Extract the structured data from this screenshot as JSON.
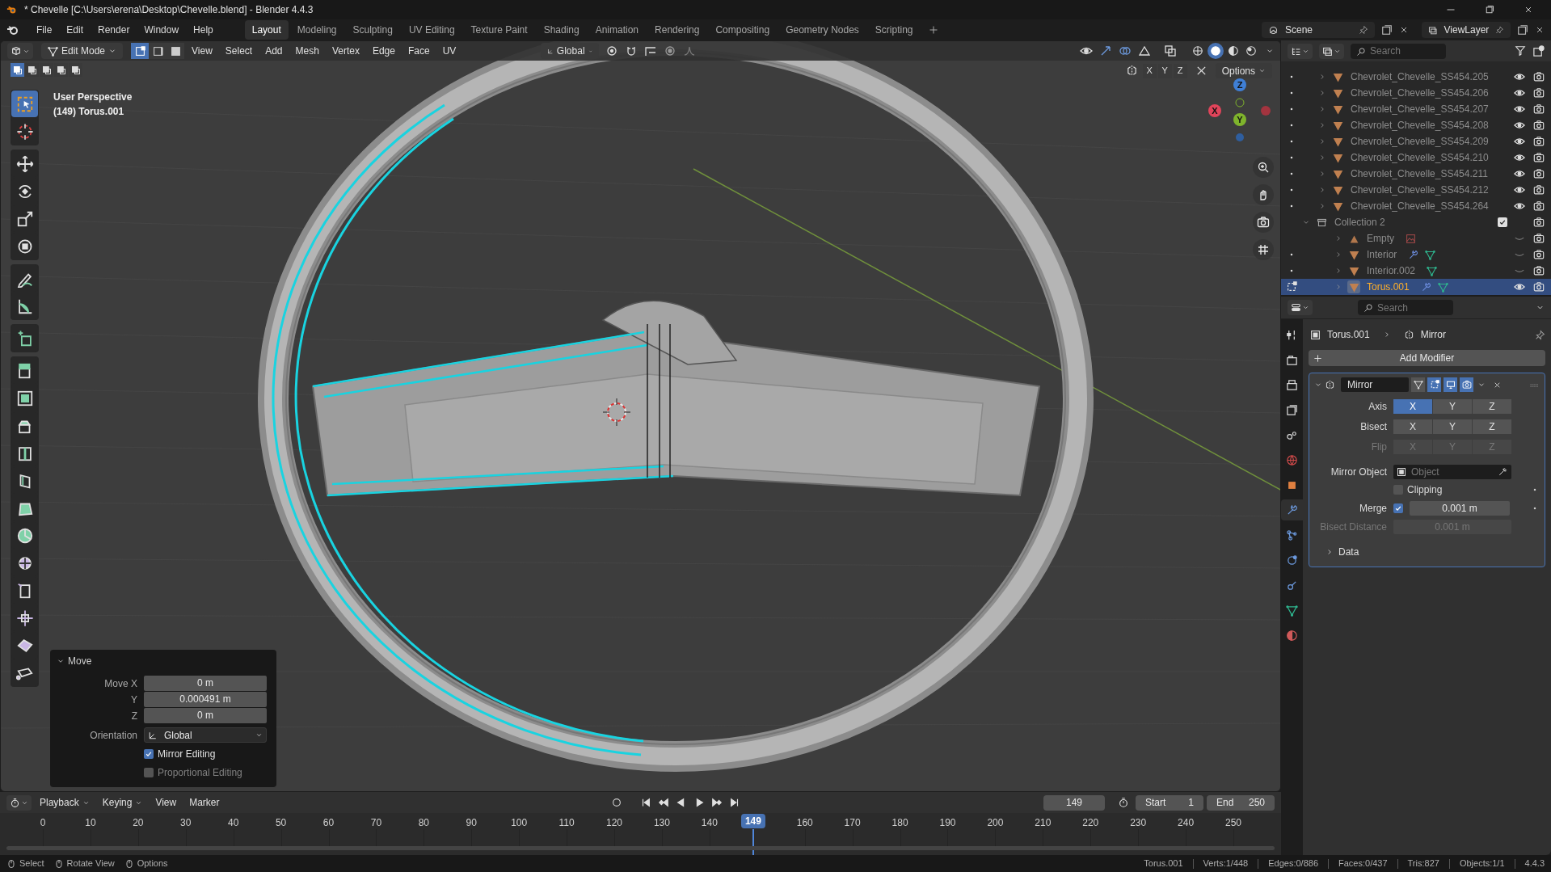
{
  "title_bar": {
    "title": "* Chevelle [C:\\Users\\erena\\Desktop\\Chevelle.blend] - Blender 4.4.3"
  },
  "top_menu": [
    "File",
    "Edit",
    "Render",
    "Window",
    "Help"
  ],
  "workspace_tabs": [
    {
      "label": "Layout",
      "selected": true
    },
    {
      "label": "Modeling",
      "selected": false
    },
    {
      "label": "Sculpting",
      "selected": false
    },
    {
      "label": "UV Editing",
      "selected": false
    },
    {
      "label": "Texture Paint",
      "selected": false
    },
    {
      "label": "Shading",
      "selected": false
    },
    {
      "label": "Animation",
      "selected": false
    },
    {
      "label": "Rendering",
      "selected": false
    },
    {
      "label": "Compositing",
      "selected": false
    },
    {
      "label": "Geometry Nodes",
      "selected": false
    },
    {
      "label": "Scripting",
      "selected": false
    }
  ],
  "scene": "Scene",
  "view_layer": "ViewLayer",
  "viewport": {
    "header": {
      "mode": "Edit Mode",
      "select_modes": [
        {
          "kind": "vertex",
          "selected": true
        },
        {
          "kind": "edge",
          "selected": false
        },
        {
          "kind": "face",
          "selected": false
        }
      ],
      "menus": [
        "View",
        "Select",
        "Add",
        "Mesh",
        "Vertex",
        "Edge",
        "Face",
        "UV"
      ],
      "orientation": "Global",
      "shading_modes": [
        {
          "kind": "wireframe",
          "selected": false
        },
        {
          "kind": "solid",
          "selected": true
        },
        {
          "kind": "material",
          "selected": false
        },
        {
          "kind": "rendered",
          "selected": false
        }
      ]
    },
    "tool_header": {
      "box_modes": [
        {
          "selected": true
        },
        {
          "selected": false
        },
        {
          "selected": false
        },
        {
          "selected": false
        },
        {
          "selected": false
        }
      ],
      "symmetry": [
        {
          "label": "X",
          "selected": false
        },
        {
          "label": "Y",
          "selected": false
        },
        {
          "label": "Z",
          "selected": false
        }
      ],
      "options": "Options"
    },
    "overlay_text": [
      "User Perspective",
      "(149) Torus.001"
    ],
    "gizmo_axes": [
      "X",
      "Y",
      "Z"
    ],
    "tool_groups": [
      {
        "tools": [
          {
            "kind": "select",
            "selected": true
          },
          {
            "kind": "cursor",
            "selected": false
          }
        ]
      },
      {
        "tools": [
          {
            "kind": "move",
            "selected": false
          },
          {
            "kind": "rotate",
            "selected": false
          },
          {
            "kind": "scale",
            "selected": false
          },
          {
            "kind": "transform",
            "selected": false
          }
        ]
      },
      {
        "tools": [
          {
            "kind": "annotate",
            "selected": false
          },
          {
            "kind": "measure",
            "selected": false
          }
        ]
      },
      {
        "tools": [
          {
            "kind": "add-cube",
            "selected": false
          }
        ]
      },
      {
        "tools": [
          {
            "kind": "extrude",
            "selected": false
          },
          {
            "kind": "inset",
            "selected": false
          },
          {
            "kind": "bevel",
            "selected": false
          },
          {
            "kind": "loop-cut",
            "selected": false
          },
          {
            "kind": "knife",
            "selected": false
          },
          {
            "kind": "poly-build",
            "selected": false
          },
          {
            "kind": "spin",
            "selected": false
          },
          {
            "kind": "smooth",
            "selected": false
          },
          {
            "kind": "edge-slide",
            "selected": false
          },
          {
            "kind": "shrink",
            "selected": false
          },
          {
            "kind": "shear",
            "selected": false
          },
          {
            "kind": "rip",
            "selected": false
          }
        ]
      }
    ],
    "last_operator": {
      "title": "Move",
      "expanded": true,
      "fields": [
        {
          "label": "Move X",
          "value": "0 m"
        },
        {
          "label": "Y",
          "value": "0.000491 m"
        },
        {
          "label": "Z",
          "value": "0 m"
        }
      ],
      "orientation": {
        "label": "Orientation",
        "value": "Global"
      },
      "checkboxes": [
        {
          "label": "Mirror Editing",
          "checked": true
        },
        {
          "label": "Proportional Editing",
          "checked": false
        }
      ]
    }
  },
  "outliner": {
    "search": {
      "placeholder": "Search"
    },
    "items": [
      {
        "name": "Chevrolet_Chevelle_SS454.205",
        "kind": "mesh",
        "edit_dot": true,
        "visible": true,
        "selected": false
      },
      {
        "name": "Chevrolet_Chevelle_SS454.206",
        "kind": "mesh",
        "edit_dot": true,
        "visible": true,
        "selected": false
      },
      {
        "name": "Chevrolet_Chevelle_SS454.207",
        "kind": "mesh",
        "edit_dot": true,
        "visible": true,
        "selected": false
      },
      {
        "name": "Chevrolet_Chevelle_SS454.208",
        "kind": "mesh",
        "edit_dot": true,
        "visible": true,
        "selected": false
      },
      {
        "name": "Chevrolet_Chevelle_SS454.209",
        "kind": "mesh",
        "edit_dot": true,
        "visible": true,
        "selected": false
      },
      {
        "name": "Chevrolet_Chevelle_SS454.210",
        "kind": "mesh",
        "edit_dot": true,
        "visible": true,
        "selected": false
      },
      {
        "name": "Chevrolet_Chevelle_SS454.211",
        "kind": "mesh",
        "edit_dot": true,
        "visible": true,
        "selected": false
      },
      {
        "name": "Chevrolet_Chevelle_SS454.212",
        "kind": "mesh",
        "edit_dot": true,
        "visible": true,
        "selected": false
      },
      {
        "name": "Chevrolet_Chevelle_SS454.264",
        "kind": "mesh",
        "edit_dot": true,
        "visible": true,
        "selected": false
      },
      {
        "name": "Collection 2",
        "kind": "collection",
        "checked": true,
        "expanded": true,
        "selected": false,
        "children": [
          {
            "name": "Empty",
            "kind": "empty",
            "visible": false,
            "selected": false,
            "image_badge": true
          },
          {
            "name": "Interior",
            "kind": "mesh",
            "edit_dot": true,
            "visible": false,
            "selected": false,
            "modifier_badge": true,
            "mesh_badge": true
          },
          {
            "name": "Interior.002",
            "kind": "mesh",
            "edit_dot": true,
            "visible": false,
            "selected": false,
            "mesh_badge": true
          },
          {
            "name": "Torus.001",
            "kind": "mesh",
            "editing": true,
            "visible": true,
            "selected": true,
            "modifier_badge": true,
            "mesh_badge": true
          }
        ]
      }
    ]
  },
  "properties": {
    "search": {
      "placeholder": "Search"
    },
    "tabs": [
      {
        "kind": "tool",
        "selected": false
      },
      {
        "kind": "render",
        "selected": false
      },
      {
        "kind": "output",
        "selected": false
      },
      {
        "kind": "view-layer",
        "selected": false
      },
      {
        "kind": "scene",
        "selected": false
      },
      {
        "kind": "world",
        "selected": false
      },
      {
        "kind": "object",
        "selected": false
      },
      {
        "kind": "modifier",
        "selected": true
      },
      {
        "kind": "particles",
        "selected": false
      },
      {
        "kind": "physics",
        "selected": false
      },
      {
        "kind": "constraints",
        "selected": false
      },
      {
        "kind": "data",
        "selected": false
      },
      {
        "kind": "material",
        "selected": false
      }
    ],
    "breadcrumb": [
      "Torus.001",
      "Mirror"
    ],
    "add_button": "Add Modifier",
    "modifier": {
      "name": "Mirror",
      "expanded": true,
      "toggles": [
        {
          "kind": "on-cage",
          "on": false
        },
        {
          "kind": "edit-mode",
          "on": true
        },
        {
          "kind": "viewport",
          "on": true
        },
        {
          "kind": "render",
          "on": true
        }
      ],
      "axis": {
        "label": "Axis",
        "options": [
          {
            "label": "X",
            "selected": true
          },
          {
            "label": "Y",
            "selected": false
          },
          {
            "label": "Z",
            "selected": false
          }
        ]
      },
      "bisect": {
        "label": "Bisect",
        "disabled": false,
        "options": [
          {
            "label": "X",
            "selected": false
          },
          {
            "label": "Y",
            "selected": false
          },
          {
            "label": "Z",
            "selected": false
          }
        ]
      },
      "flip": {
        "label": "Flip",
        "disabled": true,
        "options": [
          {
            "label": "X",
            "selected": false
          },
          {
            "label": "Y",
            "selected": false
          },
          {
            "label": "Z",
            "selected": false
          }
        ]
      },
      "mirror_object": {
        "label": "Mirror Object",
        "placeholder": "Object"
      },
      "clipping": {
        "label": "Clipping",
        "checked": false
      },
      "merge": {
        "label": "Merge",
        "checked": true,
        "value": "0.001 m"
      },
      "bisect_distance": {
        "label": "Bisect Distance",
        "value": "0.001 m",
        "disabled": true
      },
      "data_section": {
        "label": "Data",
        "expanded": false
      }
    }
  },
  "timeline": {
    "menus": [
      "Playback",
      "Keying",
      "View",
      "Marker"
    ],
    "current_frame": "149",
    "start": {
      "label": "Start",
      "value": "1"
    },
    "end": {
      "label": "End",
      "value": "250"
    },
    "ticks": [
      "0",
      "10",
      "20",
      "30",
      "40",
      "50",
      "60",
      "70",
      "80",
      "90",
      "100",
      "110",
      "120",
      "130",
      "140",
      "160",
      "170",
      "180",
      "190",
      "200",
      "210",
      "220",
      "230",
      "240",
      "250"
    ],
    "playhead": "149"
  },
  "status_bar": {
    "hints": [
      "Select",
      "Rotate View",
      "Options"
    ],
    "stats": [
      "Torus.001",
      "Verts:1/448",
      "Edges:0/886",
      "Faces:0/437",
      "Tris:827",
      "Objects:1/1",
      "4.4.3"
    ]
  }
}
